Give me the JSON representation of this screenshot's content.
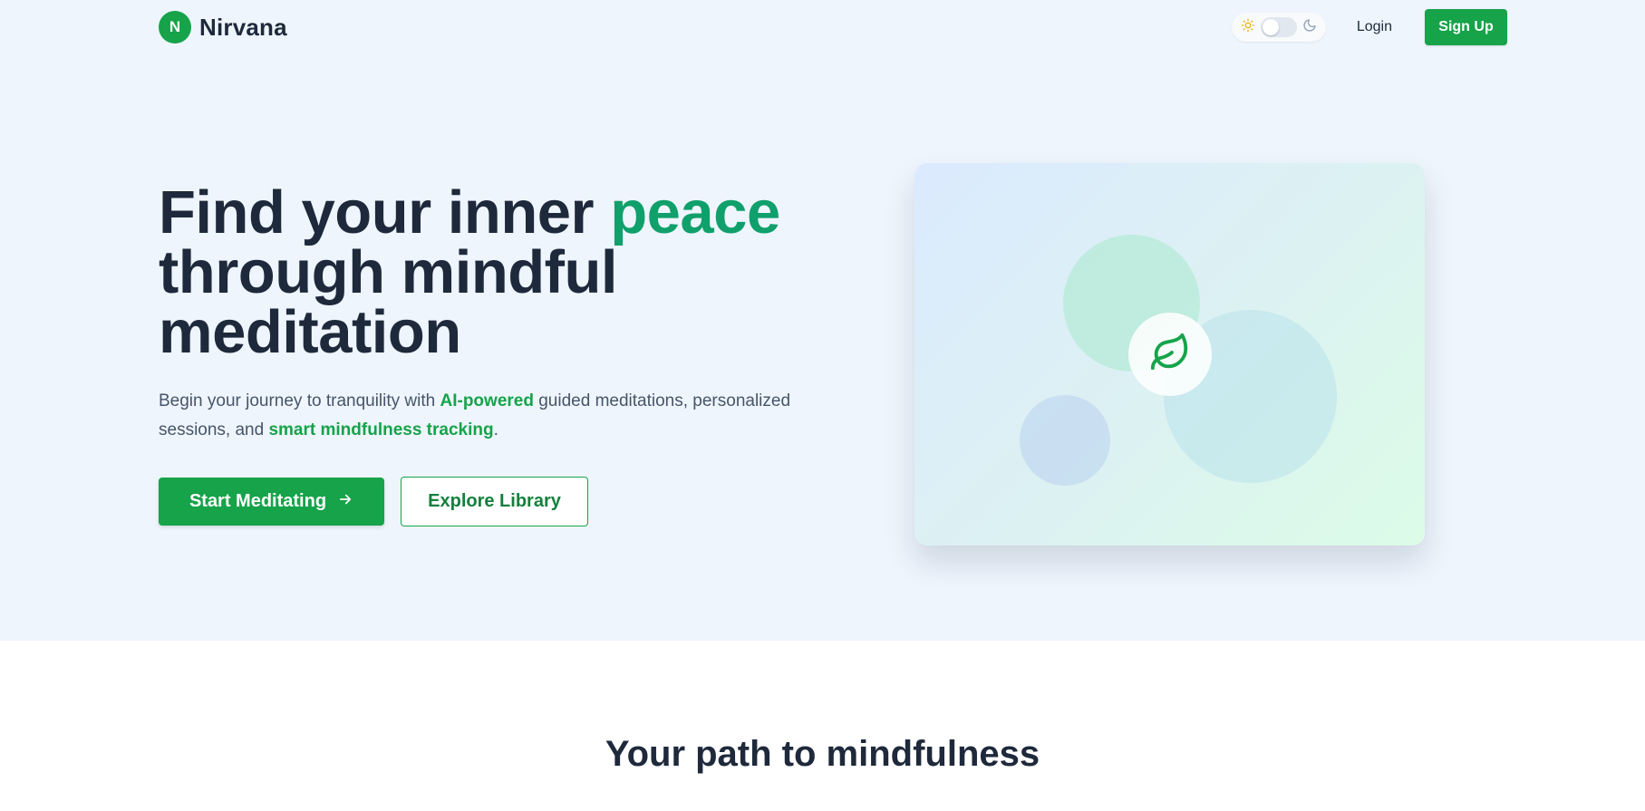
{
  "brand": {
    "initial": "N",
    "name": "Nirvana"
  },
  "nav": {
    "theme_icons": {
      "light": "sun-icon",
      "dark": "moon-icon"
    },
    "theme_toggle_on": false,
    "login_label": "Login",
    "signup_label": "Sign Up"
  },
  "hero": {
    "title_part1": "Find your inner ",
    "title_accent": "peace",
    "title_part2": "through mindful meditation",
    "sub_part1": "Begin your journey to tranquility with ",
    "sub_hl1": "AI-powered",
    "sub_part2": " guided meditations, personalized sessions, and ",
    "sub_hl2": "smart mindfulness tracking",
    "sub_part3": ".",
    "primary_label": "Start Meditating",
    "primary_icon": "arrow-right-icon",
    "secondary_label": "Explore Library",
    "illustration_icon": "leaf-icon"
  },
  "section": {
    "title": "Your path to mindfulness"
  },
  "colors": {
    "brand_green": "#16a34a",
    "accent_teal": "#10a06b",
    "hero_bg": "#eef5fd",
    "heading": "#1e293b"
  }
}
